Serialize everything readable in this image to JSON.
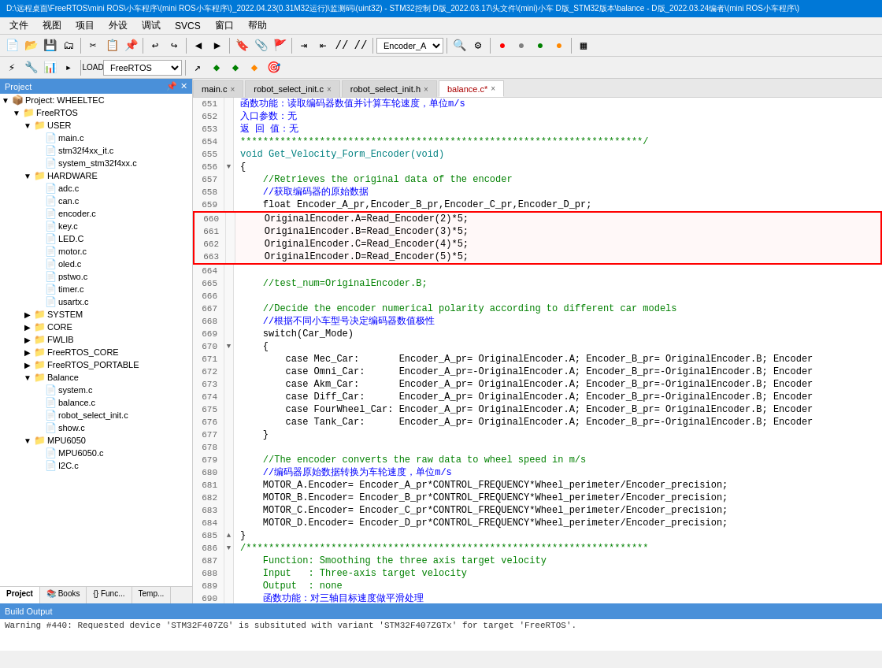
{
  "titlebar": {
    "text": "D:\\远程桌面\\FreeRTOS\\mini ROS\\小车程序\\(mini ROS小车程序\\)_2022.04.23(0.31M32运行)\\监测码\\(uint32) - STM32控制 D版_2022.03.17\\头文件\\(mini)小车 D版_STM32版本\\balance - D版_2022.03.24编者\\(mini ROS小车程序\\)"
  },
  "menubar": {
    "items": [
      "文件",
      "视图",
      "项目",
      "外设",
      "调试",
      "SVCS",
      "窗口",
      "帮助"
    ]
  },
  "toolbar1": {
    "dropdown_value": "Encoder_A"
  },
  "toolbar2": {
    "dropdown_value": "FreeRTOS"
  },
  "project": {
    "header": "Project",
    "tree": [
      {
        "id": "proj-wheeltec",
        "label": "Project: WHEELTEC",
        "indent": 0,
        "icon": "📁",
        "arrow": "▼",
        "type": "project"
      },
      {
        "id": "freertos",
        "label": "FreeRTOS",
        "indent": 1,
        "icon": "📁",
        "arrow": "▼",
        "type": "folder"
      },
      {
        "id": "user",
        "label": "USER",
        "indent": 2,
        "icon": "📁",
        "arrow": "▼",
        "type": "folder"
      },
      {
        "id": "main-c",
        "label": "main.c",
        "indent": 3,
        "icon": "📄",
        "arrow": "",
        "type": "file"
      },
      {
        "id": "stm32f4xx-it",
        "label": "stm32f4xx_it.c",
        "indent": 3,
        "icon": "📄",
        "arrow": "",
        "type": "file"
      },
      {
        "id": "system-stm32",
        "label": "system_stm32f4xx.c",
        "indent": 3,
        "icon": "📄",
        "arrow": "",
        "type": "file"
      },
      {
        "id": "hardware",
        "label": "HARDWARE",
        "indent": 2,
        "icon": "📁",
        "arrow": "▼",
        "type": "folder"
      },
      {
        "id": "adc-c",
        "label": "adc.c",
        "indent": 3,
        "icon": "📄",
        "arrow": "",
        "type": "file"
      },
      {
        "id": "can-c",
        "label": "can.c",
        "indent": 3,
        "icon": "📄",
        "arrow": "",
        "type": "file"
      },
      {
        "id": "encoder-c",
        "label": "encoder.c",
        "indent": 3,
        "icon": "📄",
        "arrow": "",
        "type": "file"
      },
      {
        "id": "key-c",
        "label": "key.c",
        "indent": 3,
        "icon": "📄",
        "arrow": "",
        "type": "file"
      },
      {
        "id": "led-c",
        "label": "LED.C",
        "indent": 3,
        "icon": "📄",
        "arrow": "",
        "type": "file"
      },
      {
        "id": "motor-c",
        "label": "motor.c",
        "indent": 3,
        "icon": "📄",
        "arrow": "",
        "type": "file"
      },
      {
        "id": "oled-c",
        "label": "oled.c",
        "indent": 3,
        "icon": "📄",
        "arrow": "",
        "type": "file"
      },
      {
        "id": "pstwo-c",
        "label": "pstwo.c",
        "indent": 3,
        "icon": "📄",
        "arrow": "",
        "type": "file"
      },
      {
        "id": "timer-c",
        "label": "timer.c",
        "indent": 3,
        "icon": "📄",
        "arrow": "",
        "type": "file"
      },
      {
        "id": "usartx-c",
        "label": "usartx.c",
        "indent": 3,
        "icon": "📄",
        "arrow": "",
        "type": "file"
      },
      {
        "id": "system",
        "label": "SYSTEM",
        "indent": 2,
        "icon": "📁",
        "arrow": "▶",
        "type": "folder",
        "collapsed": true
      },
      {
        "id": "core",
        "label": "CORE",
        "indent": 2,
        "icon": "📁",
        "arrow": "▶",
        "type": "folder",
        "collapsed": true
      },
      {
        "id": "fwlib",
        "label": "FWLIB",
        "indent": 2,
        "icon": "📁",
        "arrow": "▶",
        "type": "folder",
        "collapsed": true
      },
      {
        "id": "freertos-core",
        "label": "FreeRTOS_CORE",
        "indent": 2,
        "icon": "📁",
        "arrow": "▶",
        "type": "folder",
        "collapsed": true
      },
      {
        "id": "freertos-portable",
        "label": "FreeRTOS_PORTABLE",
        "indent": 2,
        "icon": "📁",
        "arrow": "▶",
        "type": "folder",
        "collapsed": true
      },
      {
        "id": "balance-folder",
        "label": "Balance",
        "indent": 2,
        "icon": "📁",
        "arrow": "▼",
        "type": "folder"
      },
      {
        "id": "system-c",
        "label": "system.c",
        "indent": 3,
        "icon": "📄",
        "arrow": "",
        "type": "file"
      },
      {
        "id": "balance-c",
        "label": "balance.c",
        "indent": 3,
        "icon": "📄",
        "arrow": "",
        "type": "file"
      },
      {
        "id": "robot-select-init",
        "label": "robot_select_init.c",
        "indent": 3,
        "icon": "📄",
        "arrow": "",
        "type": "file"
      },
      {
        "id": "show-c",
        "label": "show.c",
        "indent": 3,
        "icon": "📄",
        "arrow": "",
        "type": "file"
      },
      {
        "id": "mpu6050-folder",
        "label": "MPU6050",
        "indent": 2,
        "icon": "📁",
        "arrow": "▼",
        "type": "folder"
      },
      {
        "id": "mpu6050-c",
        "label": "MPU6050.c",
        "indent": 3,
        "icon": "📄",
        "arrow": "",
        "type": "file"
      },
      {
        "id": "i2c-c",
        "label": "I2C.c",
        "indent": 3,
        "icon": "📄",
        "arrow": "",
        "type": "file"
      }
    ],
    "tabs": [
      "Project",
      "Books",
      "Func...",
      "Temp..."
    ]
  },
  "tabs": [
    {
      "id": "main-c",
      "label": "main.c",
      "active": false,
      "modified": false
    },
    {
      "id": "robot-select-init-c",
      "label": "robot_select_init.c",
      "active": false,
      "modified": false
    },
    {
      "id": "robot-select-init-h",
      "label": "robot_select_init.h",
      "active": false,
      "modified": false
    },
    {
      "id": "balance-c",
      "label": "balance.c*",
      "active": true,
      "modified": true
    }
  ],
  "code": {
    "lines": [
      {
        "num": 651,
        "marker": "",
        "content": "函数功能：读取编码器数值并计算车轮速度，单位m/s",
        "type": "comment-cn"
      },
      {
        "num": 652,
        "marker": "",
        "content": "入口参数：无",
        "type": "comment-cn"
      },
      {
        "num": 653,
        "marker": "",
        "content": "返 回 值：无",
        "type": "comment-cn"
      },
      {
        "num": 654,
        "marker": "",
        "content": "***********************************************************************/",
        "type": "comment"
      },
      {
        "num": 655,
        "marker": "",
        "content": "void Get_Velocity_Form_Encoder(void)",
        "type": "func"
      },
      {
        "num": 656,
        "marker": "▼",
        "content": "{",
        "type": "normal"
      },
      {
        "num": 657,
        "marker": "",
        "content": "    //Retrieves the original data of the encoder",
        "type": "comment"
      },
      {
        "num": 658,
        "marker": "",
        "content": "    //获取编码器的原始数据",
        "type": "comment-cn"
      },
      {
        "num": 659,
        "marker": "",
        "content": "    float Encoder_A_pr,Encoder_B_pr,Encoder_C_pr,Encoder_D_pr;",
        "type": "normal"
      },
      {
        "num": 660,
        "marker": "",
        "content": "    OriginalEncoder.A=Read_Encoder(2)*5;",
        "type": "red-box"
      },
      {
        "num": 661,
        "marker": "",
        "content": "    OriginalEncoder.B=Read_Encoder(3)*5;",
        "type": "red-box"
      },
      {
        "num": 662,
        "marker": "",
        "content": "    OriginalEncoder.C=Read_Encoder(4)*5;",
        "type": "red-box"
      },
      {
        "num": 663,
        "marker": "",
        "content": "    OriginalEncoder.D=Read_Encoder(5)*5;",
        "type": "red-box"
      },
      {
        "num": 664,
        "marker": "",
        "content": "",
        "type": "normal"
      },
      {
        "num": 665,
        "marker": "",
        "content": "    //test_num=OriginalEncoder.B;",
        "type": "comment"
      },
      {
        "num": 666,
        "marker": "",
        "content": "",
        "type": "normal"
      },
      {
        "num": 667,
        "marker": "",
        "content": "    //Decide the encoder numerical polarity according to different car models",
        "type": "comment"
      },
      {
        "num": 668,
        "marker": "",
        "content": "    //根据不同小车型号决定编码器数值极性",
        "type": "comment-cn"
      },
      {
        "num": 669,
        "marker": "",
        "content": "    switch(Car_Mode)",
        "type": "normal"
      },
      {
        "num": 670,
        "marker": "▼",
        "content": "    {",
        "type": "normal"
      },
      {
        "num": 671,
        "marker": "",
        "content": "        case Mec_Car:       Encoder_A_pr= OriginalEncoder.A; Encoder_B_pr= OriginalEncoder.B; Encoder",
        "type": "normal"
      },
      {
        "num": 672,
        "marker": "",
        "content": "        case Omni_Car:      Encoder_A_pr=-OriginalEncoder.A; Encoder_B_pr=-OriginalEncoder.B; Encoder",
        "type": "normal"
      },
      {
        "num": 673,
        "marker": "",
        "content": "        case Akm_Car:       Encoder_A_pr= OriginalEncoder.A; Encoder_B_pr=-OriginalEncoder.B; Encoder",
        "type": "normal"
      },
      {
        "num": 674,
        "marker": "",
        "content": "        case Diff_Car:      Encoder_A_pr= OriginalEncoder.A; Encoder_B_pr=-OriginalEncoder.B; Encoder",
        "type": "normal"
      },
      {
        "num": 675,
        "marker": "",
        "content": "        case FourWheel_Car: Encoder_A_pr= OriginalEncoder.A; Encoder_B_pr= OriginalEncoder.B; Encoder",
        "type": "normal"
      },
      {
        "num": 676,
        "marker": "",
        "content": "        case Tank_Car:      Encoder_A_pr= OriginalEncoder.A; Encoder_B_pr=-OriginalEncoder.B; Encoder",
        "type": "normal"
      },
      {
        "num": 677,
        "marker": "",
        "content": "    }",
        "type": "normal"
      },
      {
        "num": 678,
        "marker": "",
        "content": "",
        "type": "normal"
      },
      {
        "num": 679,
        "marker": "",
        "content": "    //The encoder converts the raw data to wheel speed in m/s",
        "type": "comment"
      },
      {
        "num": 680,
        "marker": "",
        "content": "    //编码器原始数据转换为车轮速度，单位m/s",
        "type": "comment-cn"
      },
      {
        "num": 681,
        "marker": "",
        "content": "    MOTOR_A.Encoder= Encoder_A_pr*CONTROL_FREQUENCY*Wheel_perimeter/Encoder_precision;",
        "type": "normal"
      },
      {
        "num": 682,
        "marker": "",
        "content": "    MOTOR_B.Encoder= Encoder_B_pr*CONTROL_FREQUENCY*Wheel_perimeter/Encoder_precision;",
        "type": "normal"
      },
      {
        "num": 683,
        "marker": "",
        "content": "    MOTOR_C.Encoder= Encoder_C_pr*CONTROL_FREQUENCY*Wheel_perimeter/Encoder_precision;",
        "type": "normal"
      },
      {
        "num": 684,
        "marker": "",
        "content": "    MOTOR_D.Encoder= Encoder_D_pr*CONTROL_FREQUENCY*Wheel_perimeter/Encoder_precision;",
        "type": "normal"
      },
      {
        "num": 685,
        "marker": "▲",
        "content": "}",
        "type": "normal"
      },
      {
        "num": 686,
        "marker": "▼",
        "content": "/***********************************************************************",
        "type": "comment"
      },
      {
        "num": 687,
        "marker": "",
        "content": "    Function: Smoothing the three axis target velocity",
        "type": "comment"
      },
      {
        "num": 688,
        "marker": "",
        "content": "    Input   : Three-axis target velocity",
        "type": "comment"
      },
      {
        "num": 689,
        "marker": "",
        "content": "    Output  : none",
        "type": "comment"
      },
      {
        "num": 690,
        "marker": "",
        "content": "    函数功能：对三轴目标速度做平滑处理",
        "type": "comment-cn"
      }
    ]
  },
  "build_output": {
    "header": "Build Output",
    "message": "Warning #440: Requested device 'STM32F407ZG' is subsituted with variant 'STM32F407ZGTx' for target 'FreeRTOS'."
  },
  "project_panel_tabs": [
    "Project",
    "Books",
    "{} Func...",
    "Temp..."
  ]
}
